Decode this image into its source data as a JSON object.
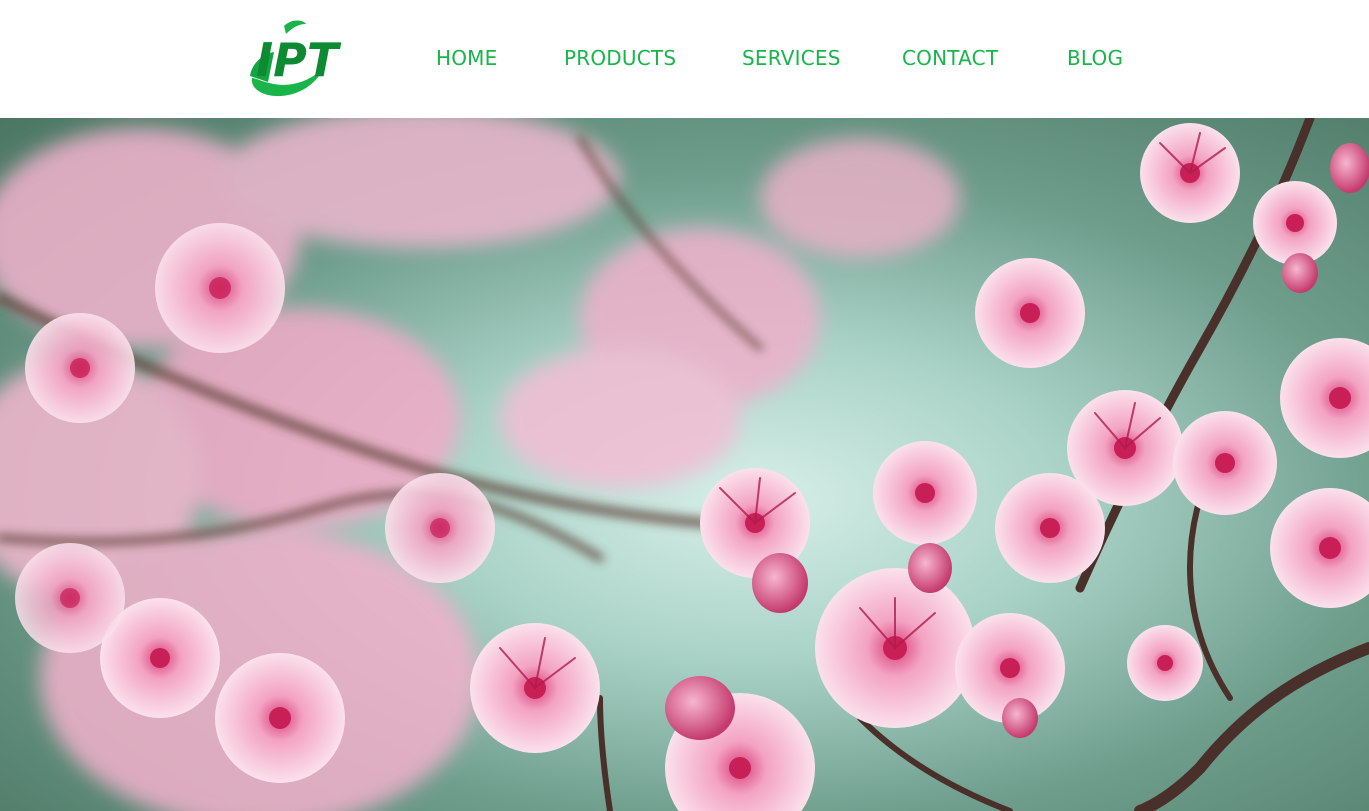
{
  "brand": {
    "logo_text": "IPT",
    "colors": {
      "green": "#19b54b",
      "dark_green": "#0e8a33",
      "white": "#ffffff"
    }
  },
  "nav": {
    "items": [
      {
        "label": "HOME"
      },
      {
        "label": "PRODUCTS"
      },
      {
        "label": "SERVICES"
      },
      {
        "label": "CONTACT"
      },
      {
        "label": "BLOG"
      }
    ]
  },
  "hero": {
    "image": "cherry-blossom-photo"
  }
}
